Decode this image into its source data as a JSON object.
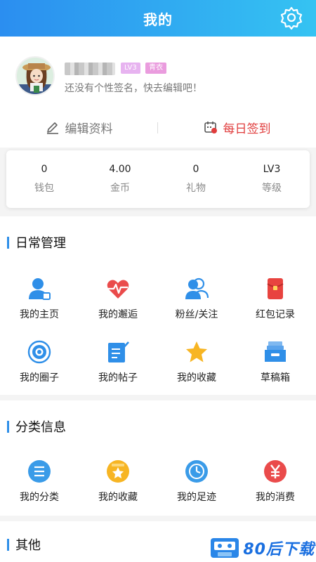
{
  "header": {
    "title": "我的"
  },
  "profile": {
    "level_badge": "LV3",
    "title_badge": "青衣",
    "signature": "还没有个性签名，快去编辑吧！",
    "edit_label": "编辑资料",
    "checkin_label": "每日签到"
  },
  "stats": [
    {
      "value": "0",
      "label": "钱包"
    },
    {
      "value": "4.00",
      "label": "金币"
    },
    {
      "value": "0",
      "label": "礼物"
    },
    {
      "value": "LV3",
      "label": "等级"
    }
  ],
  "daily": {
    "title": "日常管理",
    "items": [
      {
        "label": "我的主页",
        "icon": "user-home-icon"
      },
      {
        "label": "我的邂逅",
        "icon": "heartbeat-icon"
      },
      {
        "label": "粉丝/关注",
        "icon": "followers-icon"
      },
      {
        "label": "红包记录",
        "icon": "red-envelope-icon"
      },
      {
        "label": "我的圈子",
        "icon": "circle-target-icon"
      },
      {
        "label": "我的帖子",
        "icon": "post-edit-icon"
      },
      {
        "label": "我的收藏",
        "icon": "star-icon"
      },
      {
        "label": "草稿箱",
        "icon": "drafts-tray-icon"
      }
    ]
  },
  "category": {
    "title": "分类信息",
    "items": [
      {
        "label": "我的分类",
        "icon": "list-icon"
      },
      {
        "label": "我的收藏",
        "icon": "star-box-icon"
      },
      {
        "label": "我的足迹",
        "icon": "clock-icon"
      },
      {
        "label": "我的消费",
        "icon": "yuan-icon"
      }
    ]
  },
  "other": {
    "title": "其他"
  },
  "watermark": {
    "text": "80后下载"
  },
  "colors": {
    "header_start": "#2b8ef0",
    "header_end": "#35c3f2",
    "accent_blue": "#2f8fe8",
    "signin_red": "#e03c3c"
  }
}
